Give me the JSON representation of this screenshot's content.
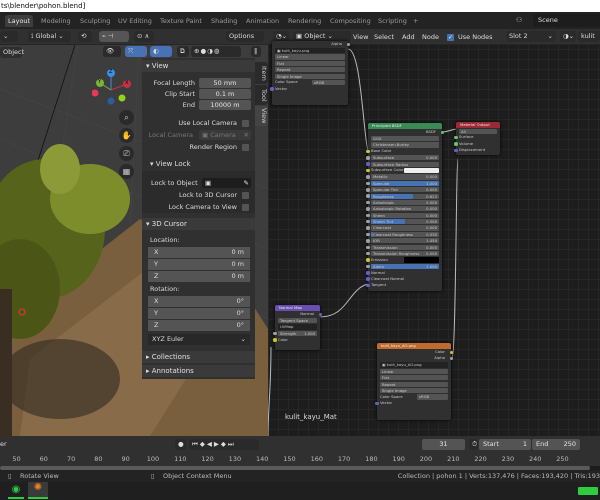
{
  "title": "ts\\blender\\pohon.blend]",
  "workspaces": [
    "Layout",
    "Modeling",
    "Sculpting",
    "UV Editing",
    "Texture Paint",
    "Shading",
    "Animation",
    "Rendering",
    "Compositing",
    "Scripting",
    "+"
  ],
  "scene": "Scene",
  "viewport": {
    "transform": "Global",
    "options": "Options",
    "mode": "Object",
    "gizmo": {
      "x": "X",
      "y": "Y",
      "z": "Z"
    }
  },
  "sidebar": {
    "tabs": [
      "Item",
      "Tool",
      "View"
    ],
    "view": {
      "title": "View",
      "focal_label": "Focal Length",
      "focal": "50 mm",
      "clip_start_label": "Clip Start",
      "clip_start": "0.1 m",
      "end_label": "End",
      "end": "10000 m",
      "use_local_camera": "Use Local Camera",
      "local_camera": "Local Camera",
      "camera": "Camera",
      "render_region": "Render Region"
    },
    "view_lock": {
      "title": "View Lock",
      "lock_object": "Lock to Object",
      "lock_cursor": "Lock to 3D Cursor",
      "lock_camera": "Lock Camera to View"
    },
    "cursor": {
      "title": "3D Cursor",
      "location": "Location:",
      "loc": [
        [
          "X",
          "0 m"
        ],
        [
          "Y",
          "0 m"
        ],
        [
          "Z",
          "0 m"
        ]
      ],
      "rotation": "Rotation:",
      "rot": [
        [
          "X",
          "0°"
        ],
        [
          "Y",
          "0°"
        ],
        [
          "Z",
          "0°"
        ]
      ],
      "mode": "XYZ Euler"
    },
    "collections": "Collections",
    "annotations": "Annotations"
  },
  "node_editor": {
    "type": "Object",
    "menu": [
      "View",
      "Select",
      "Add",
      "Node"
    ],
    "use_nodes": "Use Nodes",
    "slot": "Slot 2",
    "material": "kulit",
    "label": "kulit_kayu_Mat",
    "image1": {
      "alpha": "Alpha",
      "file": "kulit_kayu.png",
      "rows": [
        "Linear",
        "Flat",
        "Repeat",
        "Single Image"
      ],
      "cs_label": "Color Space",
      "cs": "sRGB",
      "vector": "Vector"
    },
    "bsdf": {
      "title": "Principled BSDF",
      "out": "BSDF",
      "dist": "GGX",
      "sss": "Christensen-Burley",
      "base": "Base Color",
      "inputs": [
        [
          "Subsurface",
          "0.000",
          0
        ],
        [
          "Subsurface Radius",
          "",
          -1
        ],
        [
          "Subsurface Color",
          "",
          -2
        ],
        [
          "Metallic",
          "0.000",
          0
        ],
        [
          "Specular",
          "1.000",
          1
        ],
        [
          "Specular Tint",
          "0.000",
          0
        ],
        [
          "Roughness",
          "0.623",
          0.623
        ],
        [
          "Anisotropic",
          "0.000",
          0
        ],
        [
          "Anisotropic Rotation",
          "0.000",
          0
        ],
        [
          "Sheen",
          "0.000",
          0
        ],
        [
          "Sheen Tint",
          "0.500",
          0.5
        ],
        [
          "Clearcoat",
          "0.000",
          0
        ],
        [
          "Clearcoat Roughness",
          "0.030",
          0.03
        ],
        [
          "IOR",
          "1.450",
          0
        ],
        [
          "Transmission",
          "0.000",
          0
        ],
        [
          "Transmission Roughness",
          "0.000",
          0
        ],
        [
          "Emission",
          "",
          -3
        ],
        [
          "Alpha",
          "1.000",
          1
        ]
      ],
      "vec": [
        "Normal",
        "Clearcoat Normal",
        "Tangent"
      ]
    },
    "output": {
      "title": "Material Output",
      "target": "All",
      "sockets": [
        "Surface",
        "Volume",
        "Displacement"
      ]
    },
    "normal": {
      "title": "Normal Map",
      "out": "Normal",
      "space": "Tangent Space",
      "uv": "UVMap",
      "strength_label": "Strength",
      "strength": "1.000",
      "color": "Color"
    },
    "image2": {
      "title": "kulit_kayu_AO.png",
      "color": "Color",
      "alpha": "Alpha",
      "file": "kulit_kayu_AO.png",
      "rows": [
        "Linear",
        "Flat",
        "Repeat",
        "Single Image"
      ],
      "cs_label": "Color Space",
      "cs": "sRGB",
      "vector": "Vector"
    }
  },
  "timeline": {
    "left": "er",
    "frame": "31",
    "start_label": "Start",
    "start": "1",
    "end_label": "End",
    "end": "250",
    "ticks": [
      "50",
      "60",
      "70",
      "80",
      "90",
      "100",
      "110",
      "120",
      "130",
      "140",
      "150",
      "160",
      "170",
      "180",
      "190",
      "200",
      "210",
      "220",
      "230",
      "240",
      "250"
    ]
  },
  "status": {
    "left": "Rotate View",
    "mid": "Object Context Menu",
    "right": "Collection | pohon 1 | Verts:137,476 | Faces:193,420 | Tris:193"
  }
}
